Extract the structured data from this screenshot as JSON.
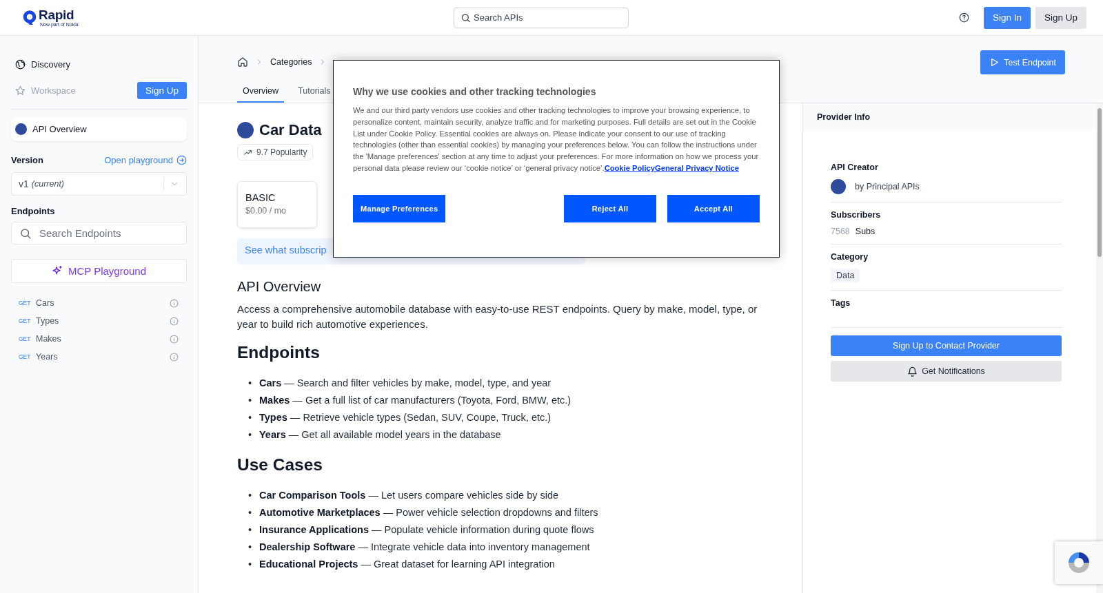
{
  "header": {
    "logo": {
      "name": "Rapid",
      "tagline": "Now part of Nokia"
    },
    "search": {
      "placeholder": "Search APIs"
    },
    "buttons": [
      {
        "label": "Sign In",
        "kind": "primary"
      },
      {
        "label": "Sign Up",
        "kind": "secondary"
      }
    ]
  },
  "sidebar": {
    "nav": [
      {
        "label": "Discovery",
        "kind": "globe",
        "disabled": false
      },
      {
        "label": "Workspace",
        "kind": "star",
        "disabled": true
      }
    ],
    "signup_button": "Sign Up",
    "api_overview": {
      "label": "API Overview",
      "selected": true
    },
    "version": {
      "label": "Version",
      "link": "Open playground",
      "value": "v1",
      "note": "(current)"
    },
    "endpoints": {
      "label": "Endpoints",
      "search": {
        "placeholder": "Search Endpoints"
      },
      "mcp_button": "MCP Playground",
      "items": [
        {
          "method": "GET",
          "name": "Cars"
        },
        {
          "method": "GET",
          "name": "Types"
        },
        {
          "method": "GET",
          "name": "Makes"
        },
        {
          "method": "GET",
          "name": "Years"
        }
      ]
    }
  },
  "main": {
    "breadcrumb": [
      "Categories"
    ],
    "tabs": [
      {
        "label": "Overview",
        "selected": true
      },
      {
        "label": "Tutorials",
        "selected": false
      }
    ],
    "test_button": "Test Endpoint",
    "title": "Car Data",
    "popularity": "9.7 Popularity",
    "plan": {
      "name": "BASIC",
      "price": "$0.00 / mo"
    },
    "banner": "See what subscrip",
    "overview": {
      "heading": "API Overview",
      "text": "Access a comprehensive automobile database with easy-to-use REST endpoints. Query by make, model, type, or year to build rich automotive experiences."
    },
    "sections": [
      {
        "heading": "Endpoints",
        "bullet": "•",
        "items": [
          "**Cars** — Search and filter vehicles by make, model, type, and year",
          "**Makes** — Get a full list of car manufacturers (Toyota, Ford, BMW, etc.)",
          "**Types** — Retrieve vehicle types (Sedan, SUV, Coupe, Truck, etc.)",
          "**Years** — Get all available model years in the database"
        ]
      },
      {
        "heading": "Use Cases",
        "bullet": "•",
        "items": [
          "**Car Comparison Tools** — Let users compare vehicles side by side",
          "**Automotive Marketplaces** — Power vehicle selection dropdowns and filters",
          "**Insurance Applications** — Populate vehicle information during quote flows",
          "**Dealership Software** — Integrate vehicle data into inventory management",
          "**Educational Projects** — Great dataset for learning API integration"
        ]
      }
    ]
  },
  "provider": {
    "title": "Provider Info",
    "creator": {
      "label": "API Creator",
      "name": "by Principal APIs"
    },
    "subscribers": {
      "label": "Subscribers",
      "count": "7568",
      "unit": "Subs"
    },
    "category": {
      "label": "Category",
      "tag": "Data"
    },
    "tags": {
      "label": "Tags"
    },
    "buttons": [
      {
        "label": "Sign Up to Contact Provider",
        "kind": "primary"
      },
      {
        "label": "Get Notifications",
        "kind": "bell"
      }
    ]
  },
  "cookie_dialog": {
    "title": "Why we use cookies and other tracking technologies",
    "body": "We and our third party vendors use cookies and other tracking technologies to improve your browsing experience, to personalize content, maintain security, analyze traffic and for marketing purposes. Full details are set out in the Cookie List under Cookie Policy. Essential cookies are always on. Please indicate your consent to our use of tracking technologies (other than essential cookies) by managing your preferences below. You can follow the instructions under the 'Manage preferences' section at any time to adjust your preferences. For more information on how we process your personal data please review our ‘cookie notice’ or ‘general privacy notice’.",
    "links": [
      "Cookie Policy",
      "General Privacy Notice"
    ],
    "buttons": [
      {
        "label": "Manage Preferences"
      },
      {
        "label": "Reject All"
      },
      {
        "label": "Accept All"
      }
    ]
  }
}
